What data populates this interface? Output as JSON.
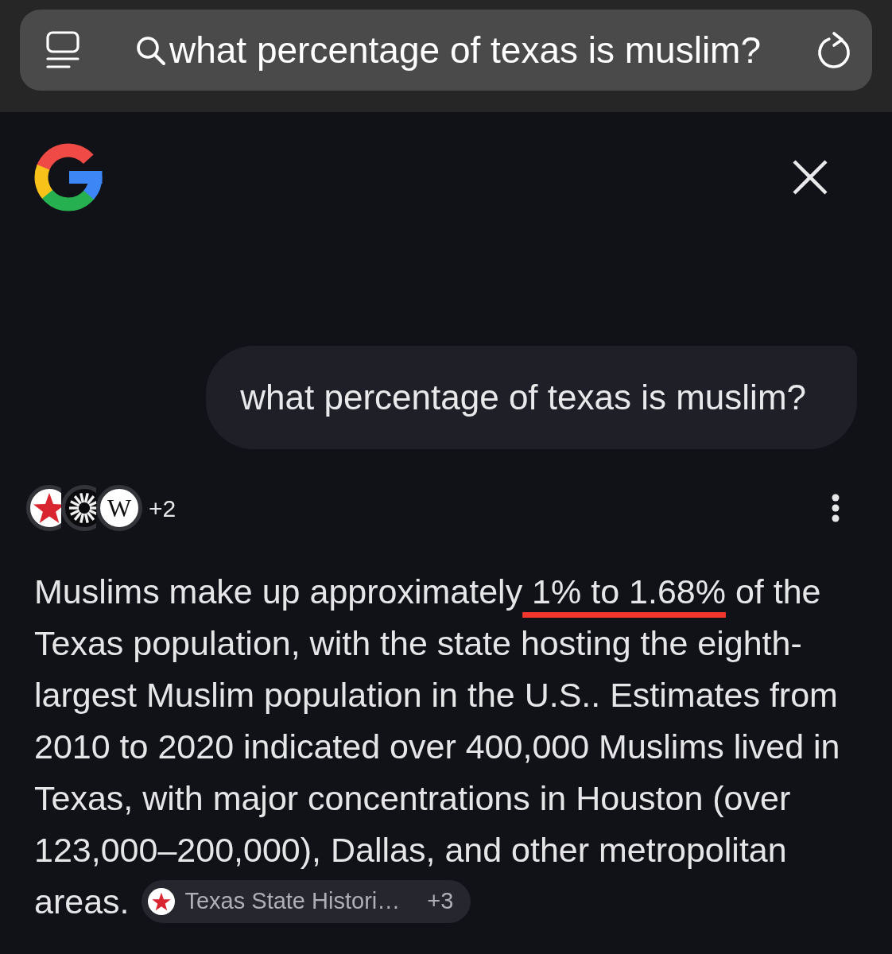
{
  "search_bar": {
    "query": "what percentage of texas is muslim?"
  },
  "user_message": {
    "text": "what percentage of texas is muslim?"
  },
  "sources": {
    "icons": [
      {
        "kind": "star"
      },
      {
        "kind": "sunburst"
      },
      {
        "kind": "letter",
        "letter": "W"
      }
    ],
    "more": "+2"
  },
  "answer": {
    "text_before": "Muslims make up approximately",
    "underlined_text": "1% to 1.68%",
    "text_after": "of the Texas population, with the state hosting the eighth-largest Muslim population in the U.S.. Estimates from 2010 to 2020 indicated over 400,000 Muslims lived in Texas, with major concentrations in Houston (over 123,000–200,000), Dallas, and other metropolitan areas.",
    "citation": {
      "label": "Texas State Histori…",
      "more": "+3"
    }
  }
}
